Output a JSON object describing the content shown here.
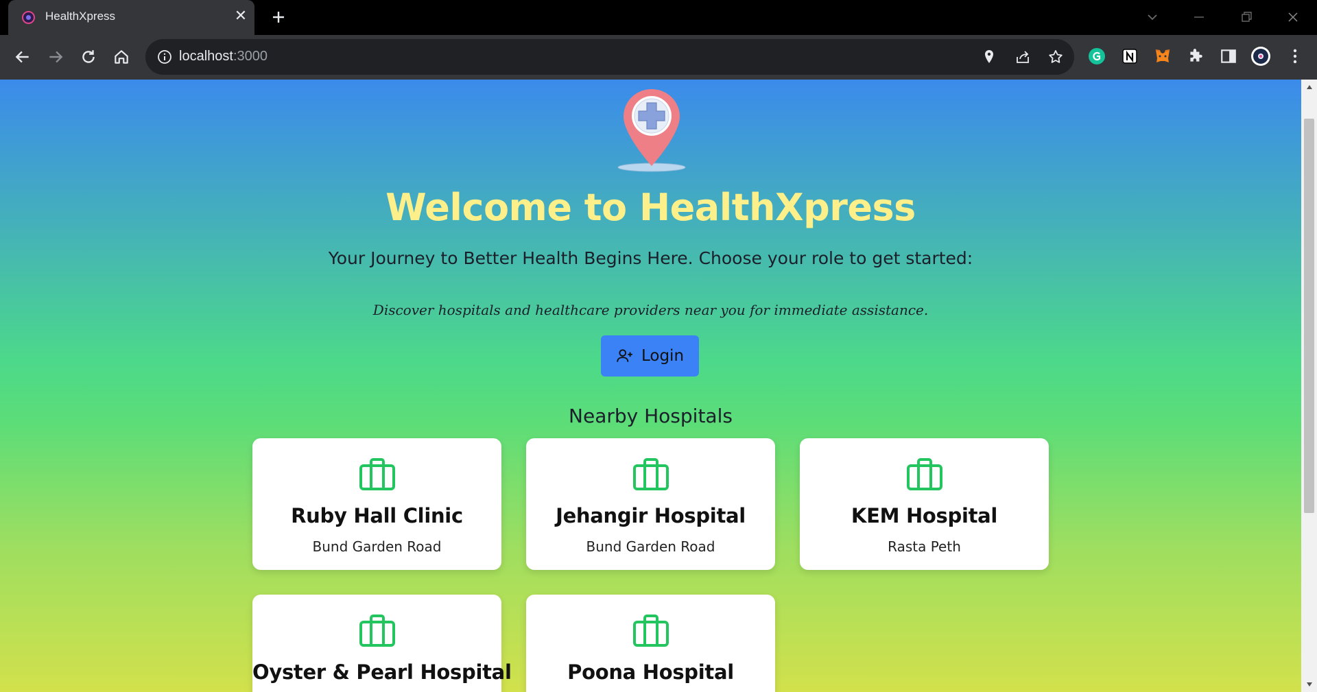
{
  "browser": {
    "tab": {
      "title": "HealthXpress",
      "favicon": "healthxpress-favicon",
      "close_icon": "close-icon"
    },
    "new_tab_icon": "plus-icon",
    "window_controls": [
      "chevron-down-icon",
      "minimize-icon",
      "restore-icon",
      "close-icon"
    ],
    "nav_icons": [
      "back-arrow-icon",
      "forward-arrow-icon",
      "reload-icon",
      "home-icon"
    ],
    "address": {
      "host": "localhost",
      "port": ":3000"
    },
    "omnibox_icons": [
      "location-pin-icon",
      "share-icon",
      "star-icon"
    ],
    "extensions": [
      "grammarly-icon",
      "notion-icon",
      "metamask-icon",
      "puzzle-icon",
      "side-panel-icon",
      "profile-avatar",
      "kebab-menu-icon"
    ]
  },
  "hero": {
    "logo": "map-pin-medical-cross-logo",
    "title": "Welcome to HealthXpress",
    "subtitle": "Your Journey to Better Health Begins Here. Choose your role to get started:",
    "tagline": "Discover hospitals and healthcare providers near you for immediate assistance.",
    "login_label": "Login",
    "login_icon": "user-plus-icon"
  },
  "nearby": {
    "title": "Nearby Hospitals",
    "hospitals": [
      {
        "name": "Ruby Hall Clinic",
        "address": "Bund Garden Road",
        "icon": "briefcase-icon"
      },
      {
        "name": "Jehangir Hospital",
        "address": "Bund Garden Road",
        "icon": "briefcase-icon"
      },
      {
        "name": "KEM Hospital",
        "address": "Rasta Peth",
        "icon": "briefcase-icon"
      },
      {
        "name": "Oyster & Pearl Hospital",
        "address": "",
        "icon": "briefcase-icon"
      },
      {
        "name": "Poona Hospital",
        "address": "",
        "icon": "briefcase-icon"
      }
    ]
  },
  "colors": {
    "title_yellow": "#fdf08a",
    "button_blue": "#3b82f6",
    "icon_green": "#22c55e",
    "gradient_top": "#3b8beb",
    "gradient_mid": "#4cd98a",
    "gradient_bottom": "#d2e14c"
  }
}
